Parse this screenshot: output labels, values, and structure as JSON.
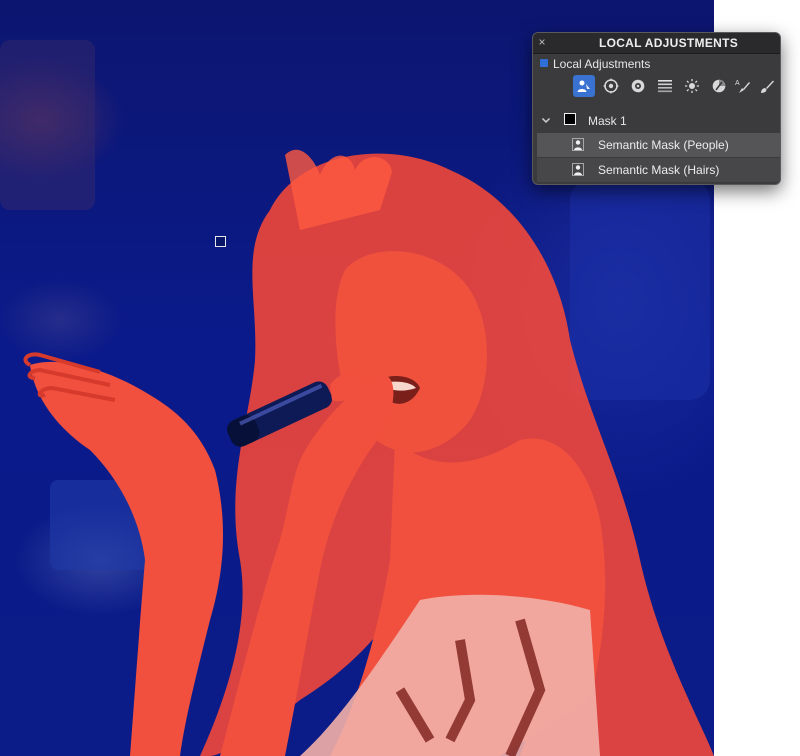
{
  "panel": {
    "title": "LOCAL ADJUSTMENTS",
    "close_glyph": "×",
    "section_label": "Local Adjustments",
    "tools": [
      {
        "icon": "people-mask-icon",
        "active": true
      },
      {
        "icon": "radial-gradient-icon",
        "active": false
      },
      {
        "icon": "object-mask-icon",
        "active": false
      },
      {
        "icon": "linear-gradient-icon",
        "active": false
      },
      {
        "icon": "brightness-icon",
        "active": false
      },
      {
        "icon": "color-picker-icon",
        "active": false
      },
      {
        "icon": "auto-brush-icon",
        "active": false
      },
      {
        "icon": "brush-icon",
        "active": false
      }
    ],
    "mask": {
      "label": "Mask 1",
      "expanded": true,
      "items": [
        {
          "label": "Semantic Mask (People)"
        },
        {
          "label": "Semantic Mask (Hairs)"
        }
      ]
    }
  },
  "colors": {
    "accent": "#3a72d2",
    "panel_bg": "#3b3b3d",
    "overlay_red": "#ff4632",
    "background_blue": "#0b1a88"
  }
}
